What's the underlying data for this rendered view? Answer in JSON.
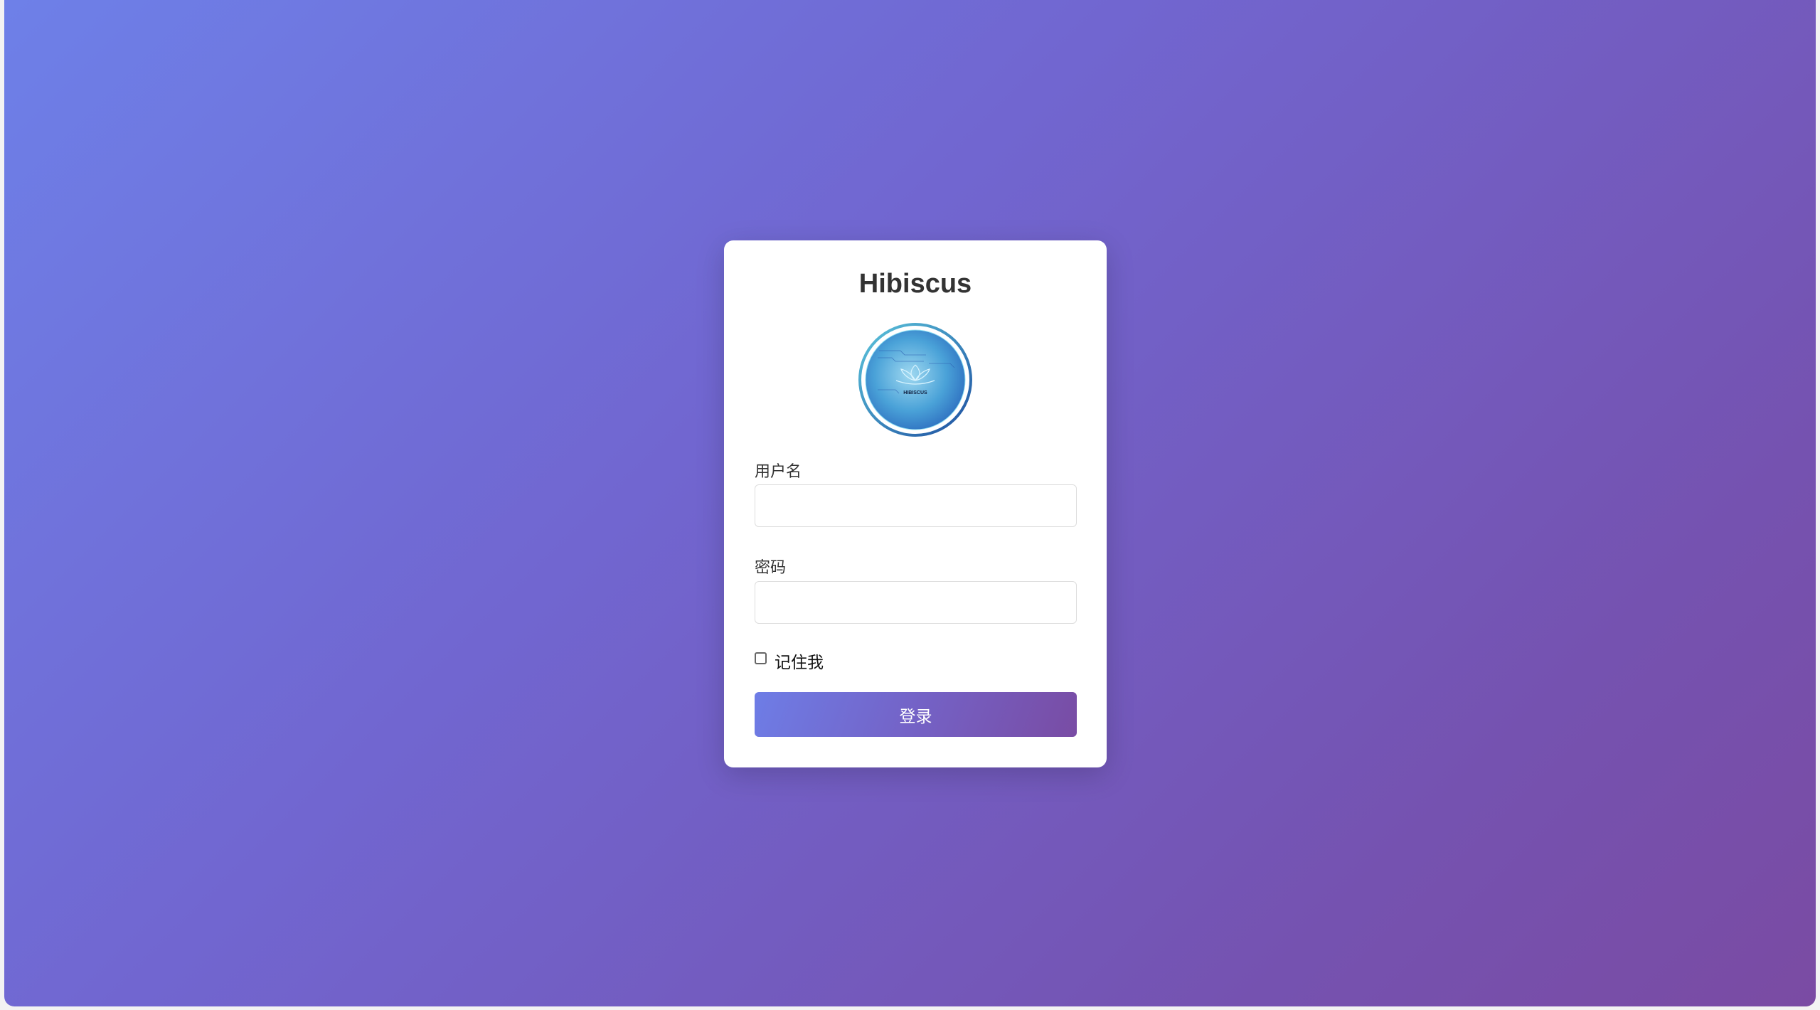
{
  "login": {
    "title": "Hibiscus",
    "logo_text": "HIBISCUS",
    "username_label": "用户名",
    "username_value": "",
    "password_label": "密码",
    "password_value": "",
    "remember_label": "记住我",
    "remember_checked": false,
    "submit_label": "登录"
  },
  "colors": {
    "gradient_start": "#667eea",
    "gradient_end": "#764ba2",
    "card": "#ffffff",
    "title": "#333333"
  }
}
